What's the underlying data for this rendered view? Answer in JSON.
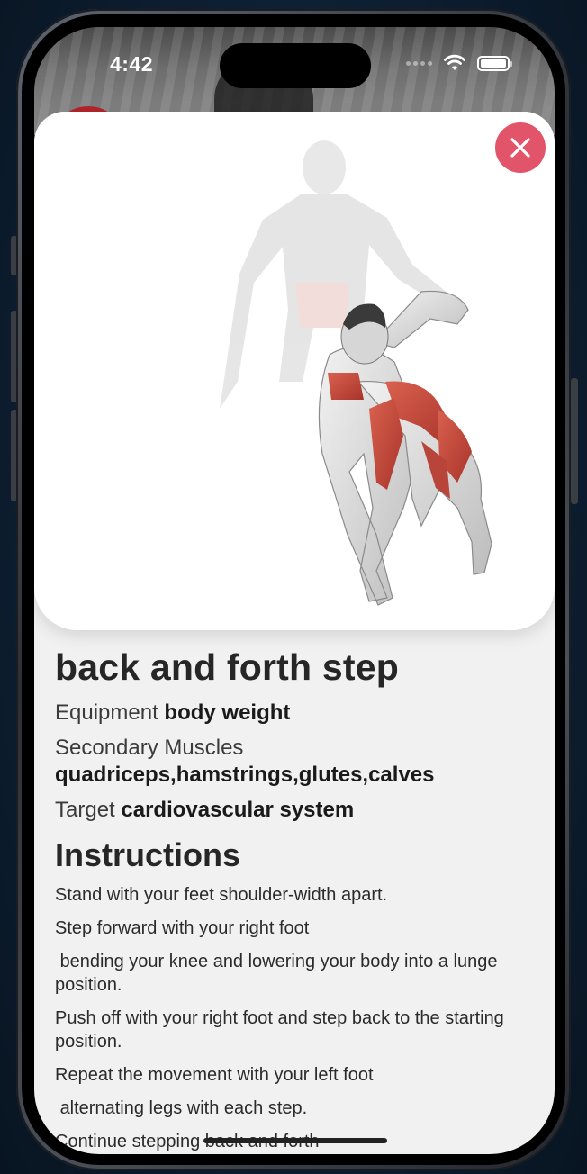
{
  "status_bar": {
    "time": "4:42",
    "icons": [
      "signal-dots-icon",
      "wifi-icon",
      "battery-icon"
    ]
  },
  "exercise": {
    "title": "back and forth step",
    "equipment_label": "Equipment",
    "equipment_value": "body weight",
    "secondary_label": "Secondary Muscles",
    "secondary_value": "quadriceps,hamstrings,glutes,calves",
    "target_label": "Target",
    "target_value": "cardiovascular system",
    "illustration_icon": "anatomy-figure-illustration"
  },
  "instructions": {
    "heading": "Instructions",
    "steps": [
      "Stand with your feet shoulder-width apart.",
      "Step forward with your right foot",
      " bending your knee and lowering your body into a lunge position.",
      "Push off with your right foot and step back to the starting position.",
      "Repeat the movement with your left foot",
      " alternating legs with each step.",
      "Continue stepping back and forth"
    ]
  },
  "close_button": {
    "icon": "close-icon",
    "color": "#e2546a"
  },
  "colors": {
    "muscle_highlight": "#c84a3c",
    "sheet_background": "#f1f1f1"
  }
}
